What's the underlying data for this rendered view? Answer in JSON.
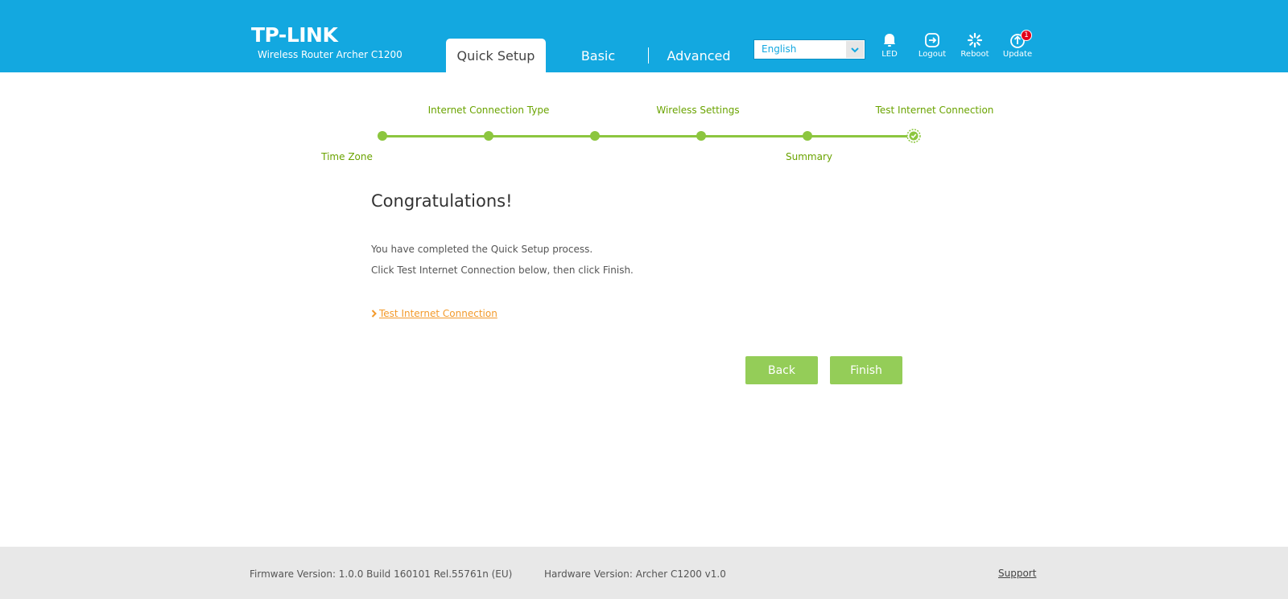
{
  "header": {
    "logo_text": "TP-LINK",
    "subtitle": "Wireless Router Archer C1200",
    "tabs": [
      {
        "label": "Quick Setup",
        "active": true
      },
      {
        "label": "Basic",
        "active": false
      },
      {
        "label": "Advanced",
        "active": false
      }
    ],
    "language": {
      "selected": "English"
    },
    "icons": [
      {
        "name": "led-icon",
        "label": "LED"
      },
      {
        "name": "logout-icon",
        "label": "Logout"
      },
      {
        "name": "reboot-icon",
        "label": "Reboot"
      },
      {
        "name": "update-icon",
        "label": "Update",
        "badge": "1"
      }
    ]
  },
  "wizard": {
    "steps_top": [
      "Internet Connection Type",
      "Wireless Settings",
      "Test Internet Connection"
    ],
    "steps_bottom": [
      "Time Zone",
      "Summary"
    ]
  },
  "content": {
    "title": "Congratulations!",
    "line1": "You have completed the Quick Setup process.",
    "line2": "Click Test Internet Connection below, then click Finish.",
    "link_text": "Test Internet Connection",
    "back_label": "Back",
    "finish_label": "Finish"
  },
  "footer": {
    "firmware": "Firmware Version: 1.0.0 Build 160101 Rel.55761n (EU)",
    "hardware": "Hardware Version: Archer C1200 v1.0",
    "support": "Support"
  },
  "colors": {
    "header_blue": "#13a8e0",
    "accent_green": "#8cc63f",
    "button_green": "#94cd58",
    "link_orange": "#f39a2b"
  }
}
